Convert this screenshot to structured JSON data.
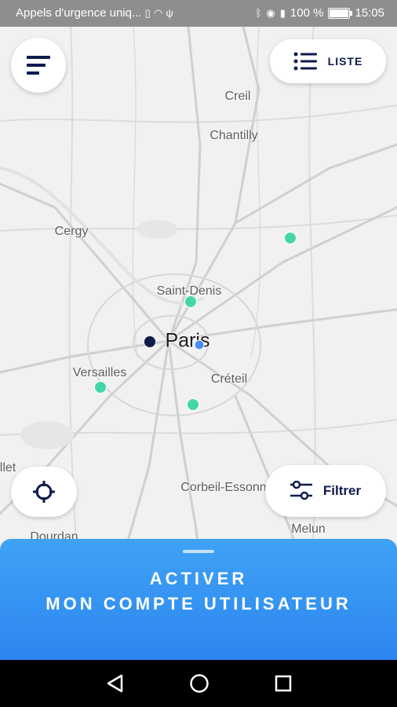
{
  "status_bar": {
    "notification_text": "Appels d'urgence uniq...",
    "battery_text": "100 %",
    "battery_level": 1.0,
    "time": "15:05"
  },
  "header": {
    "list_button_label": "LISTE"
  },
  "map": {
    "places": {
      "creil": "Creil",
      "chantilly": "Chantilly",
      "cergy": "Cergy",
      "saint_denis": "Saint-Denis",
      "paris": "Paris",
      "versailles": "Versailles",
      "creteil": "Créteil",
      "corbeil": "Corbeil-Essonn",
      "melun": "Melun",
      "dourdan": "Dourdan",
      "cut_left": "llet"
    },
    "marker_color": "#44d6a8",
    "user_location_color": "#4a8df6",
    "city_dot_color": "#0e1b4d"
  },
  "controls": {
    "filter_button_label": "Filtrer"
  },
  "bottom_sheet": {
    "line1": "ACTIVER",
    "line2": "MON COMPTE UTILISATEUR",
    "color": "#2d86f0"
  },
  "colors": {
    "brand_navy": "#0e1b4d"
  }
}
